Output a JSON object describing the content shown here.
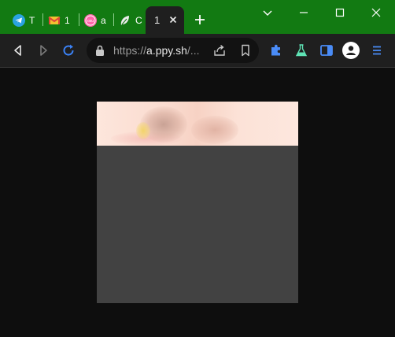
{
  "browser": {
    "tabs": [
      {
        "label": "T",
        "icon": "telegram-icon"
      },
      {
        "label": "1",
        "icon": "gmail-icon"
      },
      {
        "label": "a",
        "icon": "osu-icon"
      },
      {
        "label": "C",
        "icon": "leaf-icon"
      }
    ],
    "active_tab": {
      "label": "1"
    },
    "address": {
      "scheme": "https://",
      "host": "a.ppy.sh",
      "rest": "/..."
    },
    "colors": {
      "titlebar": "#127a12",
      "toolbar": "#1f1f1f",
      "page_background": "#0e0e0e",
      "accent": "#1a73e8"
    }
  }
}
